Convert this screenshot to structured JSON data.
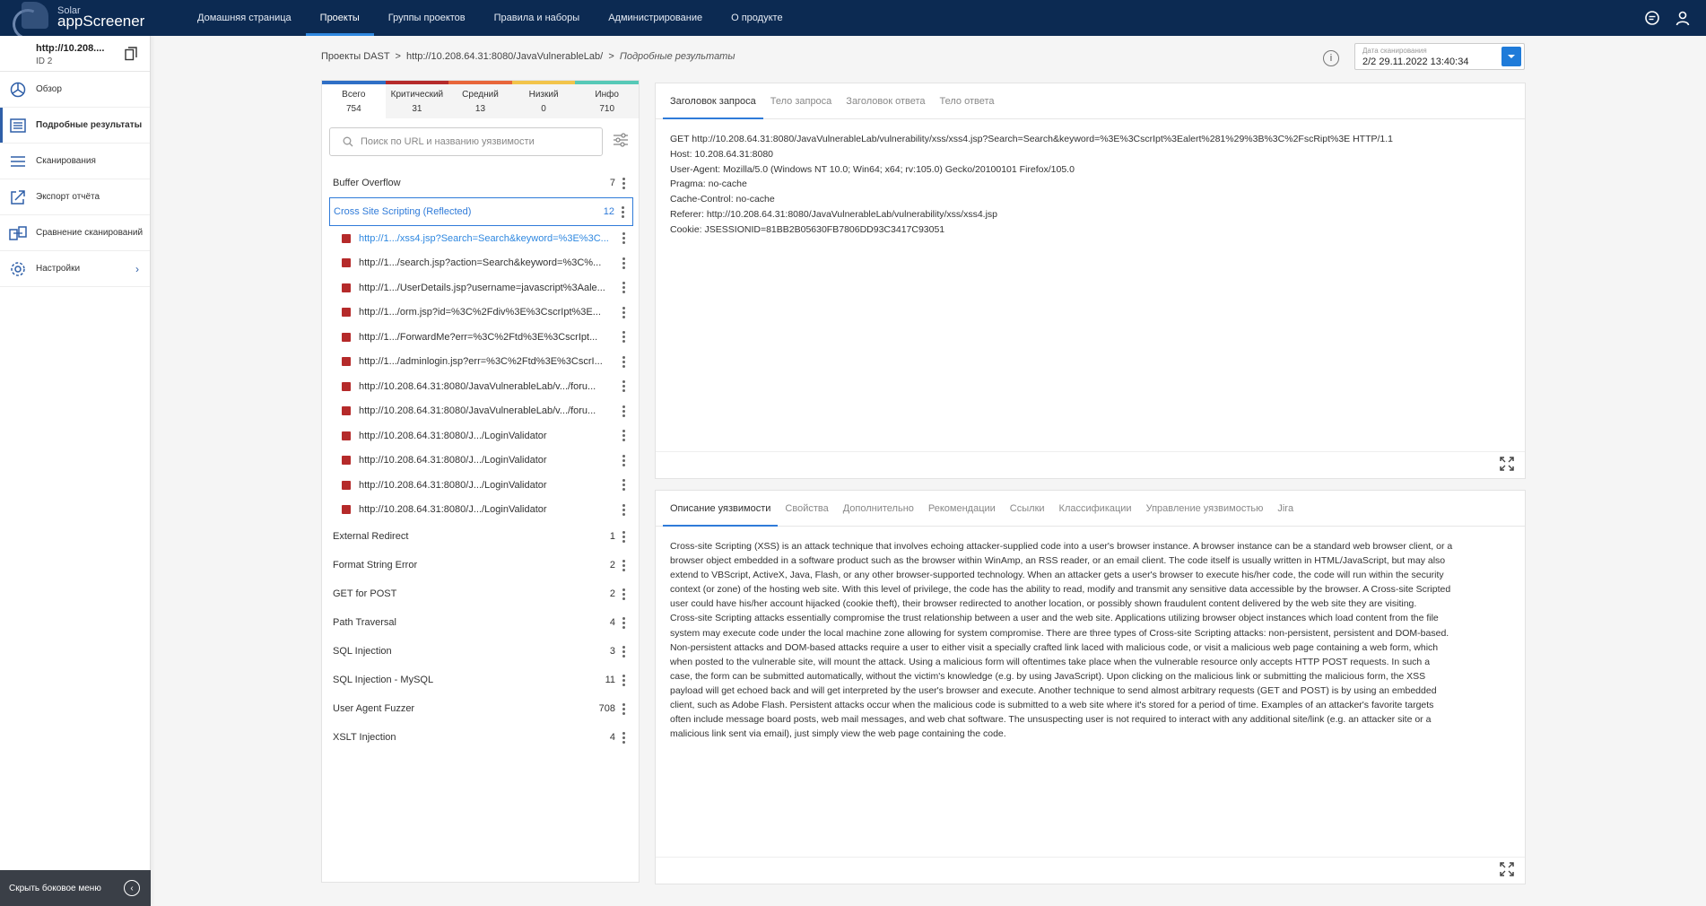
{
  "app": {
    "logo_small": "Solar",
    "logo_big": "appScreener"
  },
  "nav": [
    {
      "label": "Домашняя страница",
      "active": false
    },
    {
      "label": "Проекты",
      "active": true
    },
    {
      "label": "Группы проектов",
      "active": false
    },
    {
      "label": "Правила и наборы",
      "active": false
    },
    {
      "label": "Администрирование",
      "active": false
    },
    {
      "label": "О продукте",
      "active": false
    }
  ],
  "project": {
    "url": "http://10.208....",
    "id": "ID 2"
  },
  "sidebar": {
    "items": [
      {
        "label": "Обзор",
        "icon": "dashboard-icon"
      },
      {
        "label": "Подробные результаты",
        "icon": "list-icon",
        "active": true
      },
      {
        "label": "Сканирования",
        "icon": "scans-icon"
      },
      {
        "label": "Экспорт отчёта",
        "icon": "export-icon"
      },
      {
        "label": "Сравнение сканирований",
        "icon": "compare-icon"
      },
      {
        "label": "Настройки",
        "icon": "gear-icon"
      }
    ],
    "hide_label": "Скрыть боковое меню"
  },
  "breadcrumb": {
    "root": "Проекты DAST",
    "sep1": ">",
    "project": "http://10.208.64.31:8080/JavaVulnerableLab/",
    "sep2": ">",
    "current": "Подробные результаты"
  },
  "scan": {
    "label": "Дата сканирования",
    "value": "2/2 29.11.2022 13:40:34"
  },
  "stats": [
    {
      "label": "Всего",
      "value": "754"
    },
    {
      "label": "Критический",
      "value": "31"
    },
    {
      "label": "Средний",
      "value": "13"
    },
    {
      "label": "Низкий",
      "value": "0"
    },
    {
      "label": "Инфо",
      "value": "710"
    }
  ],
  "search": {
    "placeholder": "Поиск по URL и названию уязвимости",
    "value": ""
  },
  "categories_before": [
    {
      "name": "Buffer Overflow",
      "count": "7"
    }
  ],
  "active_category": {
    "name": "Cross Site Scripting (Reflected)",
    "count": "12"
  },
  "urls": [
    "http://1.../xss4.jsp?Search=Search&keyword=%3E%3C...",
    "http://1.../search.jsp?action=Search&keyword=%3C%...",
    "http://1.../UserDetails.jsp?username=javascript%3Aale...",
    "http://1.../orm.jsp?id=%3C%2Fdiv%3E%3CscrIpt%3E...",
    "http://1.../ForwardMe?err=%3C%2Ftd%3E%3CscrIpt...",
    "http://1.../adminlogin.jsp?err=%3C%2Ftd%3E%3CscrI...",
    "http://10.208.64.31:8080/JavaVulnerableLab/v.../foru...",
    "http://10.208.64.31:8080/JavaVulnerableLab/v.../foru...",
    "http://10.208.64.31:8080/J.../LoginValidator",
    "http://10.208.64.31:8080/J.../LoginValidator",
    "http://10.208.64.31:8080/J.../LoginValidator",
    "http://10.208.64.31:8080/J.../LoginValidator"
  ],
  "categories_after": [
    {
      "name": "External Redirect",
      "count": "1"
    },
    {
      "name": "Format String Error",
      "count": "2"
    },
    {
      "name": "GET for POST",
      "count": "2"
    },
    {
      "name": "Path Traversal",
      "count": "4"
    },
    {
      "name": "SQL Injection",
      "count": "3"
    },
    {
      "name": "SQL Injection - MySQL",
      "count": "11"
    },
    {
      "name": "User Agent Fuzzer",
      "count": "708"
    },
    {
      "name": "XSLT Injection",
      "count": "4"
    }
  ],
  "request_tabs": [
    "Заголовок запроса",
    "Тело запроса",
    "Заголовок ответа",
    "Тело ответа"
  ],
  "request_lines": [
    "GET http://10.208.64.31:8080/JavaVulnerableLab/vulnerability/xss/xss4.jsp?Search=Search&keyword=%3E%3CscrIpt%3Ealert%281%29%3B%3C%2FscRipt%3E HTTP/1.1",
    "Host: 10.208.64.31:8080",
    "User-Agent: Mozilla/5.0 (Windows NT 10.0; Win64; x64; rv:105.0) Gecko/20100101 Firefox/105.0",
    "Pragma: no-cache",
    "Cache-Control: no-cache",
    "Referer: http://10.208.64.31:8080/JavaVulnerableLab/vulnerability/xss/xss4.jsp",
    "Cookie: JSESSIONID=81BB2B05630FB7806DD93C3417C93051"
  ],
  "desc_tabs": [
    "Описание уязвимости",
    "Свойства",
    "Дополнительно",
    "Рекомендации",
    "Ссылки",
    "Классификации",
    "Управление уязвимостью",
    "Jira"
  ],
  "description": [
    "Cross-site Scripting (XSS) is an attack technique that involves echoing attacker-supplied code into a user's browser instance. A browser instance can be a standard web browser client, or a",
    "browser object embedded in a software product such as the browser within WinAmp, an RSS reader, or an email client. The code itself is usually written in HTML/JavaScript, but may also",
    "extend to VBScript, ActiveX, Java, Flash, or any other browser-supported technology. When an attacker gets a user's browser to execute his/her code, the code will run within the security",
    "context (or zone) of the hosting web site. With this level of privilege, the code has the ability to read, modify and transmit any sensitive data accessible by the browser. A Cross-site Scripted",
    "user could have his/her account hijacked (cookie theft), their browser redirected to another location, or possibly shown fraudulent content delivered by the web site they are visiting.",
    "Cross-site Scripting attacks essentially compromise the trust relationship between a user and the web site. Applications utilizing browser object instances which load content from the file",
    "system may execute code under the local machine zone allowing for system compromise. There are three types of Cross-site Scripting attacks: non-persistent, persistent and DOM-based.",
    "Non-persistent attacks and DOM-based attacks require a user to either visit a specially crafted link laced with malicious code, or visit a malicious web page containing a web form, which",
    "when posted to the vulnerable site, will mount the attack. Using a malicious form will oftentimes take place when the vulnerable resource only accepts HTTP POST requests. In such a",
    "case, the form can be submitted automatically, without the victim's knowledge (e.g. by using JavaScript). Upon clicking on the malicious link or submitting the malicious form, the XSS",
    "payload will get echoed back and will get interpreted by the user's browser and execute. Another technique to send almost arbitrary requests (GET and POST) is by using an embedded",
    "client, such as Adobe Flash. Persistent attacks occur when the malicious code is submitted to a web site where it's stored for a period of time. Examples of an attacker's favorite targets",
    "often include message board posts, web mail messages, and web chat software. The unsuspecting user is not required to interact with any additional site/link (e.g. an attacker site or a",
    "malicious link sent via email), just simply view the web page containing the code."
  ],
  "colors": {
    "topbar": "#0c2a52",
    "accent": "#2f7bd9",
    "critical": "#b52a2a",
    "medium": "#e8663a",
    "low": "#f2c44b",
    "info": "#56c9b7"
  }
}
